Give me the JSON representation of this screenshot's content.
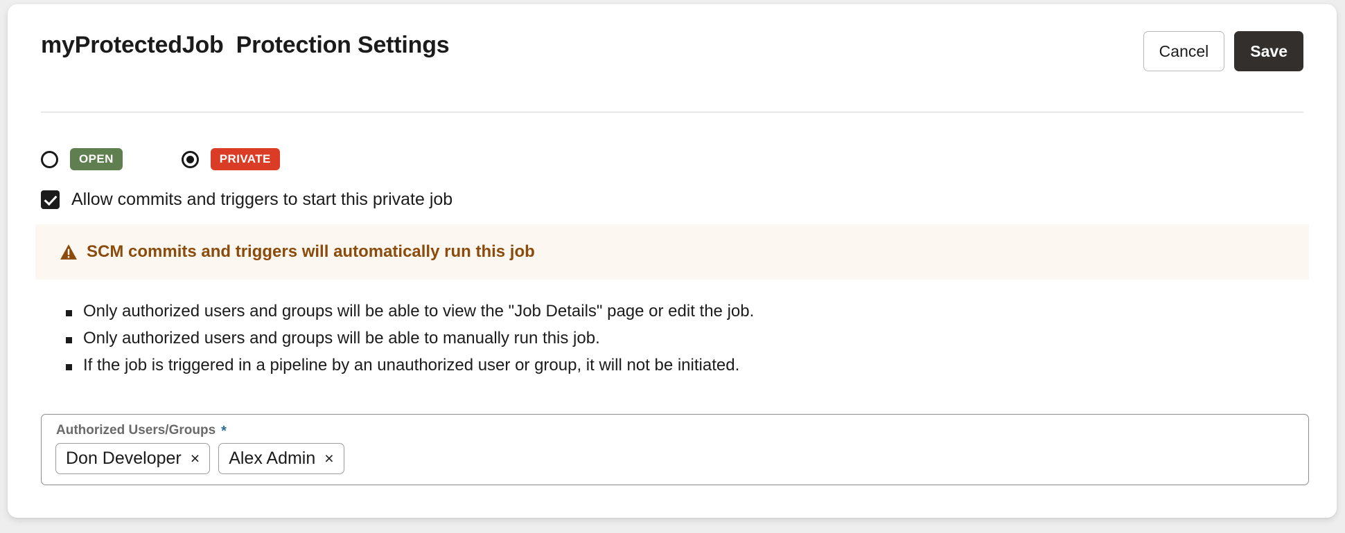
{
  "header": {
    "job_name": "myProtectedJob",
    "page_title": "Protection Settings",
    "cancel_label": "Cancel",
    "save_label": "Save"
  },
  "visibility": {
    "options": [
      {
        "value": "open",
        "badge_label": "OPEN",
        "selected": false,
        "color": "#5f7f50"
      },
      {
        "value": "private",
        "badge_label": "PRIVATE",
        "selected": true,
        "color": "#da3c25"
      }
    ]
  },
  "allow_commits": {
    "checked": true,
    "label": "Allow commits and triggers to start this private job"
  },
  "warning": {
    "icon": "warning-triangle-icon",
    "text": "SCM commits and triggers will automatically run this job",
    "text_color": "#8a4b0b",
    "background_color": "#fdf7f1"
  },
  "notes": [
    "Only authorized users and groups will be able to view the \"Job Details\" page or edit the job.",
    "Only authorized users and groups will be able to manually run this job.",
    "If the job is triggered in a pipeline by an unauthorized user or group, it will not be initiated."
  ],
  "authorized_field": {
    "label": "Authorized Users/Groups",
    "required_marker": "*",
    "required_color": "#2c6e9b",
    "chips": [
      {
        "label": "Don Developer",
        "remove_icon": "×"
      },
      {
        "label": "Alex Admin",
        "remove_icon": "×"
      }
    ]
  }
}
